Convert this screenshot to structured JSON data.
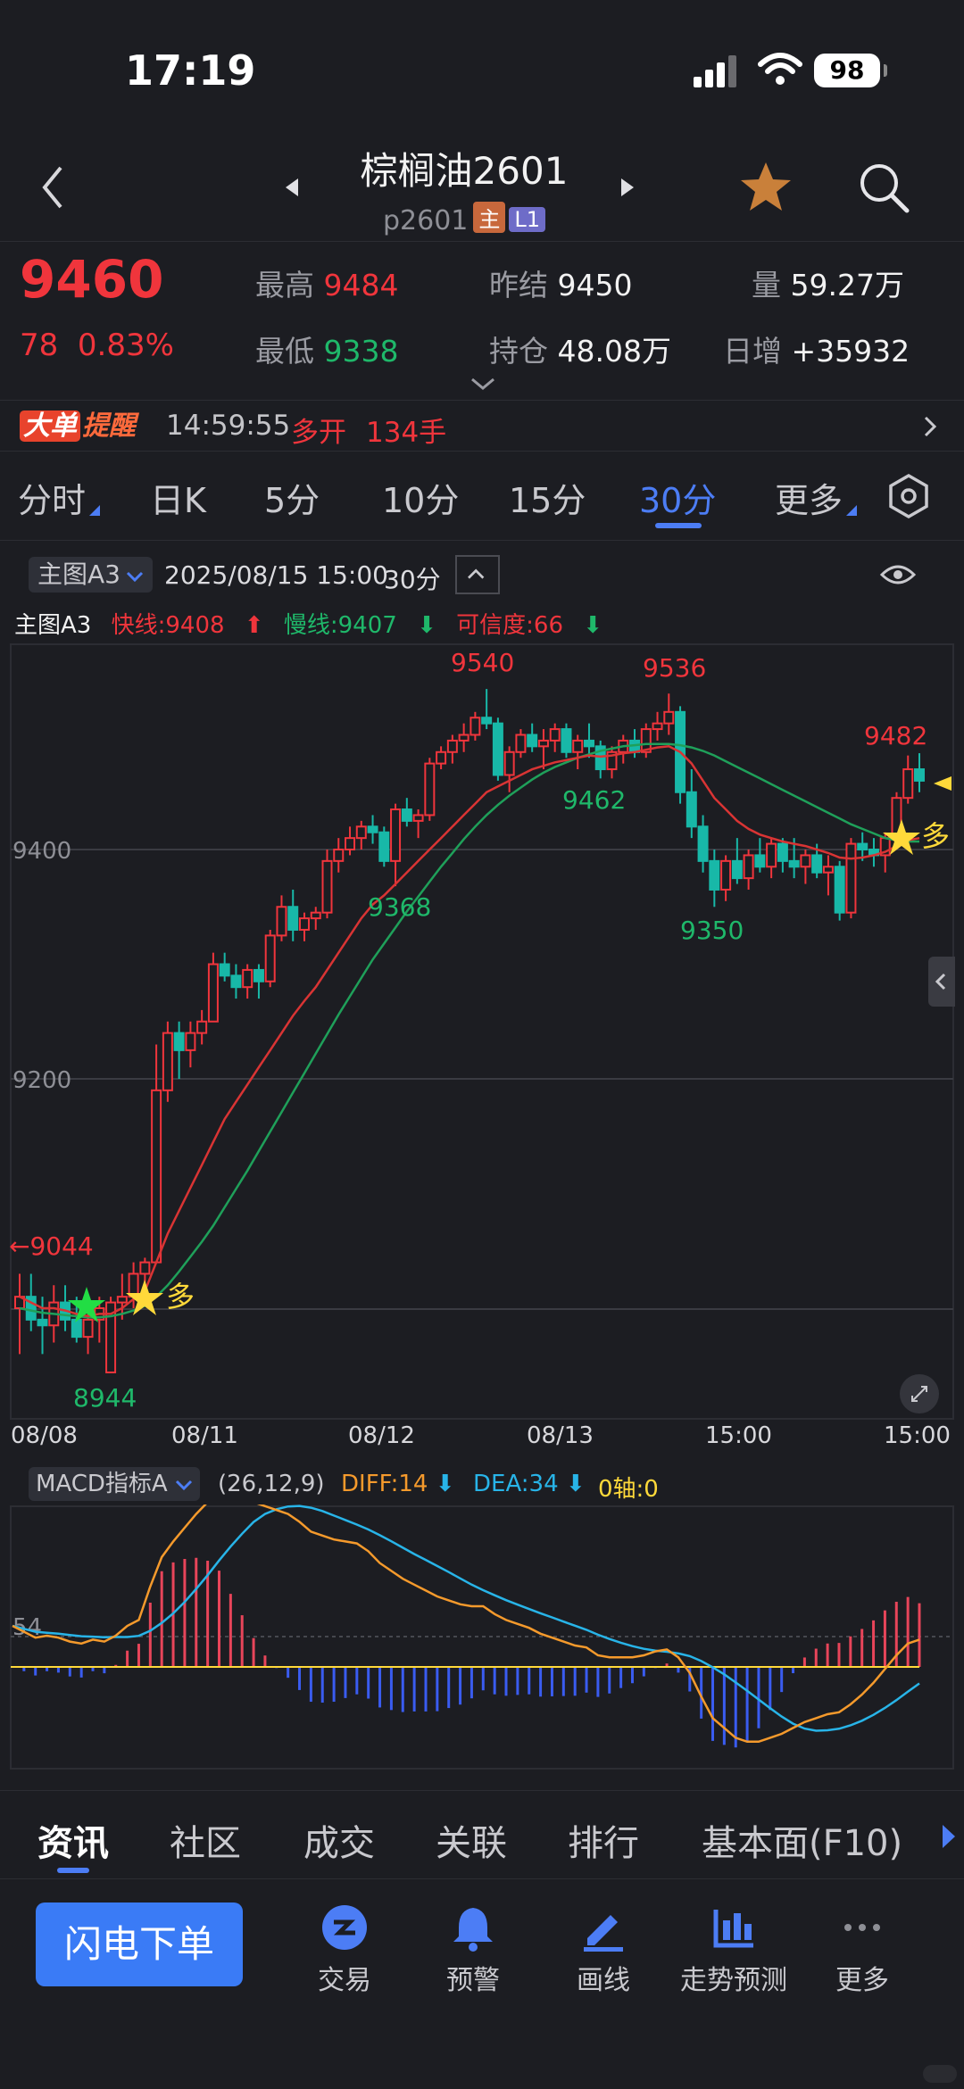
{
  "status": {
    "time": "17:19",
    "battery": "98"
  },
  "header": {
    "title": "棕榈油2601",
    "code": "p2601",
    "tag_main": "主",
    "tag_l1": "L1"
  },
  "quote": {
    "price": "9460",
    "change": "78",
    "change_pct": "0.83%",
    "high_label": "最高",
    "high": "9484",
    "low_label": "最低",
    "low": "9338",
    "prev_settle_label": "昨结",
    "prev_settle": "9450",
    "open_interest_label": "持仓",
    "open_interest": "48.08万",
    "volume_label": "量",
    "volume": "59.27万",
    "daily_inc_label": "日增",
    "daily_inc": "+35932"
  },
  "alert": {
    "badge1": "大单",
    "badge2": "提醒",
    "time": "14:59:55",
    "action": "多开",
    "qty": "134手"
  },
  "periods": [
    "分时",
    "日K",
    "5分",
    "10分",
    "15分",
    "30分",
    "更多"
  ],
  "active_period": "30分",
  "chart_header": {
    "indicator": "主图A3",
    "datetime": "2025/08/15 15:00",
    "period": "30分"
  },
  "legend": {
    "name": "主图A3",
    "fast": "快线:9408",
    "slow": "慢线:9407",
    "confidence": "可信度:66"
  },
  "chart_labels": {
    "y_ticks": [
      "9400",
      "9200"
    ],
    "peak1": "9540",
    "peak2": "9536",
    "peak3": "9482",
    "low_start": "8944",
    "trough1": "9368",
    "trough2": "9462",
    "trough3": "9350",
    "arrow_label": "←9044",
    "signal_long": "多"
  },
  "chart_data": {
    "type": "candlestick",
    "x_ticks": [
      "08/08",
      "08/11",
      "08/12",
      "08/13",
      "15:00",
      "15:00"
    ],
    "y_ticks": [
      9400,
      9200
    ],
    "ylim": [
      8900,
      9580
    ],
    "candles": [
      [
        9000,
        9030,
        8960,
        9010
      ],
      [
        9010,
        9030,
        8980,
        8990
      ],
      [
        8990,
        9010,
        8960,
        8985
      ],
      [
        8985,
        9020,
        8970,
        9005
      ],
      [
        9005,
        9020,
        8980,
        8990
      ],
      [
        8990,
        9010,
        8970,
        8975
      ],
      [
        8975,
        9000,
        8960,
        8990
      ],
      [
        8990,
        9010,
        8970,
        9000
      ],
      [
        8944,
        9010,
        8944,
        9005
      ],
      [
        9005,
        9030,
        8990,
        9010
      ],
      [
        9010,
        9040,
        9000,
        9030
      ],
      [
        9030,
        9044,
        9020,
        9040
      ],
      [
        9040,
        9230,
        9040,
        9190
      ],
      [
        9190,
        9250,
        9180,
        9240
      ],
      [
        9240,
        9250,
        9200,
        9225
      ],
      [
        9225,
        9250,
        9210,
        9240
      ],
      [
        9240,
        9260,
        9230,
        9250
      ],
      [
        9250,
        9310,
        9250,
        9300
      ],
      [
        9300,
        9310,
        9285,
        9290
      ],
      [
        9290,
        9300,
        9270,
        9280
      ],
      [
        9280,
        9300,
        9270,
        9295
      ],
      [
        9295,
        9300,
        9270,
        9285
      ],
      [
        9285,
        9330,
        9280,
        9325
      ],
      [
        9325,
        9360,
        9320,
        9350
      ],
      [
        9350,
        9365,
        9320,
        9330
      ],
      [
        9330,
        9345,
        9320,
        9340
      ],
      [
        9340,
        9350,
        9330,
        9345
      ],
      [
        9345,
        9400,
        9340,
        9390
      ],
      [
        9390,
        9410,
        9380,
        9400
      ],
      [
        9400,
        9420,
        9395,
        9410
      ],
      [
        9410,
        9425,
        9400,
        9420
      ],
      [
        9420,
        9430,
        9405,
        9415
      ],
      [
        9415,
        9420,
        9385,
        9390
      ],
      [
        9390,
        9440,
        9368,
        9435
      ],
      [
        9435,
        9445,
        9420,
        9425
      ],
      [
        9425,
        9435,
        9410,
        9430
      ],
      [
        9430,
        9480,
        9425,
        9475
      ],
      [
        9475,
        9490,
        9470,
        9485
      ],
      [
        9485,
        9500,
        9475,
        9495
      ],
      [
        9495,
        9510,
        9485,
        9500
      ],
      [
        9500,
        9520,
        9495,
        9515
      ],
      [
        9515,
        9540,
        9505,
        9510
      ],
      [
        9510,
        9515,
        9460,
        9465
      ],
      [
        9465,
        9490,
        9450,
        9485
      ],
      [
        9485,
        9505,
        9480,
        9500
      ],
      [
        9500,
        9510,
        9485,
        9490
      ],
      [
        9490,
        9505,
        9470,
        9495
      ],
      [
        9495,
        9510,
        9485,
        9505
      ],
      [
        9505,
        9510,
        9480,
        9485
      ],
      [
        9485,
        9500,
        9470,
        9495
      ],
      [
        9495,
        9510,
        9480,
        9490
      ],
      [
        9490,
        9495,
        9462,
        9470
      ],
      [
        9470,
        9490,
        9462,
        9485
      ],
      [
        9485,
        9500,
        9475,
        9495
      ],
      [
        9495,
        9505,
        9480,
        9485
      ],
      [
        9485,
        9510,
        9480,
        9505
      ],
      [
        9505,
        9520,
        9495,
        9510
      ],
      [
        9510,
        9536,
        9500,
        9520
      ],
      [
        9520,
        9525,
        9440,
        9450
      ],
      [
        9450,
        9470,
        9410,
        9420
      ],
      [
        9420,
        9430,
        9380,
        9390
      ],
      [
        9390,
        9400,
        9350,
        9365
      ],
      [
        9365,
        9395,
        9355,
        9390
      ],
      [
        9390,
        9410,
        9370,
        9375
      ],
      [
        9375,
        9400,
        9365,
        9395
      ],
      [
        9395,
        9410,
        9380,
        9385
      ],
      [
        9385,
        9410,
        9375,
        9405
      ],
      [
        9405,
        9410,
        9380,
        9390
      ],
      [
        9390,
        9410,
        9375,
        9385
      ],
      [
        9385,
        9400,
        9370,
        9395
      ],
      [
        9395,
        9405,
        9375,
        9380
      ],
      [
        9380,
        9395,
        9360,
        9385
      ],
      [
        9385,
        9390,
        9338,
        9345
      ],
      [
        9345,
        9410,
        9340,
        9405
      ],
      [
        9405,
        9415,
        9390,
        9400
      ],
      [
        9400,
        9410,
        9385,
        9395
      ],
      [
        9395,
        9415,
        9380,
        9410
      ],
      [
        9410,
        9450,
        9400,
        9445
      ],
      [
        9445,
        9482,
        9440,
        9470
      ],
      [
        9470,
        9484,
        9450,
        9460
      ]
    ],
    "fast_line": [
      9010,
      9005,
      9000,
      9000,
      8998,
      8995,
      8993,
      8995,
      8995,
      9000,
      9008,
      9015,
      9040,
      9065,
      9085,
      9105,
      9125,
      9145,
      9165,
      9180,
      9195,
      9210,
      9225,
      9240,
      9255,
      9268,
      9280,
      9295,
      9310,
      9325,
      9340,
      9352,
      9360,
      9370,
      9380,
      9390,
      9400,
      9410,
      9420,
      9430,
      9440,
      9450,
      9455,
      9460,
      9465,
      9470,
      9473,
      9476,
      9478,
      9480,
      9482,
      9481,
      9482,
      9484,
      9485,
      9487,
      9489,
      9490,
      9485,
      9475,
      9460,
      9445,
      9435,
      9425,
      9418,
      9413,
      9410,
      9407,
      9405,
      9403,
      9400,
      9397,
      9393,
      9392,
      9393,
      9395,
      9398,
      9403,
      9408,
      9410
    ],
    "slow_line": [
      9000,
      8998,
      8996,
      8995,
      8994,
      8993,
      8992,
      8992,
      8993,
      8995,
      8998,
      9002,
      9010,
      9020,
      9032,
      9045,
      9058,
      9072,
      9088,
      9104,
      9120,
      9137,
      9154,
      9171,
      9188,
      9205,
      9222,
      9239,
      9256,
      9272,
      9288,
      9304,
      9318,
      9332,
      9346,
      9359,
      9372,
      9385,
      9397,
      9409,
      9420,
      9430,
      9439,
      9447,
      9454,
      9461,
      9467,
      9472,
      9476,
      9480,
      9483,
      9486,
      9488,
      9490,
      9491,
      9492,
      9492,
      9492,
      9491,
      9489,
      9486,
      9482,
      9477,
      9472,
      9467,
      9462,
      9457,
      9452,
      9447,
      9442,
      9437,
      9432,
      9427,
      9422,
      9418,
      9414,
      9410,
      9408,
      9407,
      9407
    ],
    "markers": [
      {
        "label": "9540",
        "price": 9540
      },
      {
        "label": "9536",
        "price": 9536
      },
      {
        "label": "9482",
        "price": 9482
      },
      {
        "label": "8944",
        "price": 8944
      },
      {
        "label": "9368",
        "price": 9368
      },
      {
        "label": "9462",
        "price": 9462
      },
      {
        "label": "9350",
        "price": 9350
      }
    ]
  },
  "macd": {
    "indicator": "MACD指标A",
    "params": "(26,12,9)",
    "diff": "DIFF:14",
    "dea": "DEA:34",
    "zero": "0轴:0",
    "y_tick": "54"
  },
  "bottom_tabs": [
    "资讯",
    "社区",
    "成交",
    "关联",
    "排行",
    "基本面(F10)"
  ],
  "actions": {
    "flash": "闪电下单",
    "trade": "交易",
    "alert": "预警",
    "draw": "画线",
    "forecast": "走势预测",
    "more": "更多"
  }
}
